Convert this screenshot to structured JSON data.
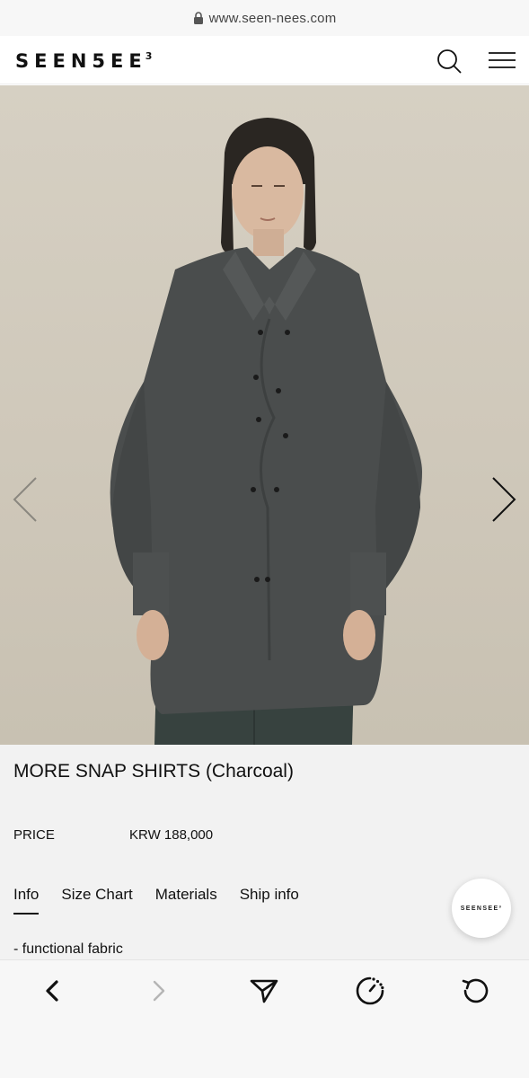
{
  "browser": {
    "url": "www.seen-nees.com"
  },
  "header": {
    "logo_text": "SEEN5EE",
    "logo_superscript": "3"
  },
  "product": {
    "title": "MORE SNAP SHIRTS (Charcoal)",
    "price_label": "PRICE",
    "price_value": "KRW 188,000",
    "tabs": [
      {
        "label": "Info",
        "active": true
      },
      {
        "label": "Size Chart",
        "active": false
      },
      {
        "label": "Materials",
        "active": false
      },
      {
        "label": "Ship info",
        "active": false
      }
    ],
    "description_line": "- functional fabric"
  },
  "floating_badge": {
    "text": "SEENSEE³"
  },
  "colors": {
    "photo_background": "#d3cdbf",
    "shirt": "#4a4d4d",
    "text": "#111111",
    "info_background": "#f2f2f2"
  }
}
